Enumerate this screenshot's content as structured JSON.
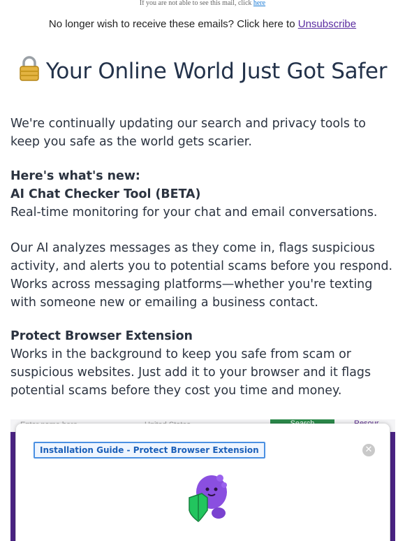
{
  "top_note": {
    "text": "If you are not able to see this mail, click",
    "link": "here"
  },
  "unsubscribe": {
    "text": "No longer wish to receive these emails? Click here to",
    "link": "Unsubscribe"
  },
  "hero": {
    "title": "Your Online World Just Got Safer",
    "icon": "lock-icon"
  },
  "intro": "We're continually updating our search and privacy tools to keep you safe as the world gets scarier.",
  "whats_new": "Here's what's new:",
  "feature1": {
    "title": "AI Chat Checker Tool (BETA)",
    "subtitle": "Real-time monitoring for your chat and email conversations.",
    "body": "Our AI analyzes messages as they come in, flags suspicious activity, and alerts you to potential scams before you respond. Works across messaging platforms—whether you're texting with someone new or emailing a business contact."
  },
  "feature2": {
    "title": "Protect Browser Extension",
    "body": "Works in the background to keep you safe from scam or suspicious websites. Just add it to your browser and it flags potential scams before they cost you time and money."
  },
  "screenshot": {
    "search_placeholder": "Enter name here",
    "country": "United States",
    "search_button": "Search",
    "resources": "Resour",
    "modal_title": "Installation Guide - Protect Browser Extension",
    "close_icon": "close-icon",
    "mascot": "shield-mascot-icon"
  },
  "colors": {
    "link": "#5a2ca0",
    "hero_text": "#23324a",
    "accent_purple": "#4a2383",
    "pill_border": "#4a90e2"
  }
}
